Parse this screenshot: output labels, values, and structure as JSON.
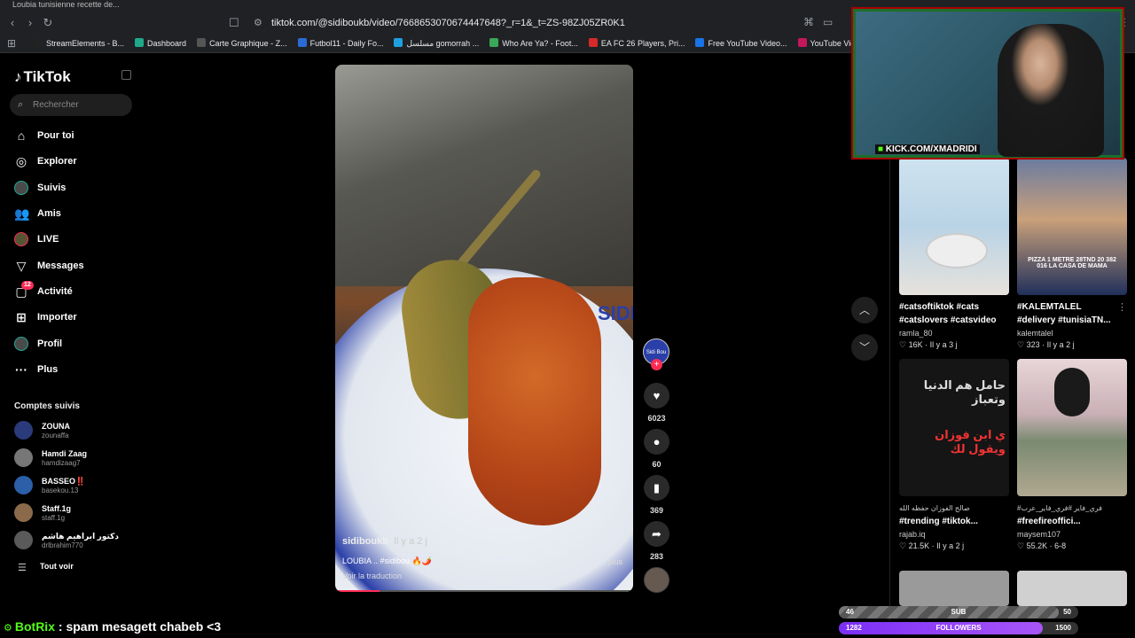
{
  "browser": {
    "tab_title": "Loubia tunisienne recette de...",
    "url": "tiktok.com/@sidiboukb/video/7668653070674447648?_r=1&_t=ZS-98ZJ05ZR0K1",
    "bookmarks": [
      {
        "label": "StreamElements - B...",
        "color": "#222"
      },
      {
        "label": "Dashboard",
        "color": "#1fa88a"
      },
      {
        "label": "Carte Graphique - Z...",
        "color": "#555"
      },
      {
        "label": "Futbol11 - Daily Fo...",
        "color": "#2a6bd6"
      },
      {
        "label": "مسلسل gomorrah ...",
        "color": "#1ea0e0"
      },
      {
        "label": "Who Are Ya? - Foot...",
        "color": "#3aa857"
      },
      {
        "label": "EA FC 26 Players, Pri...",
        "color": "#d62a2a"
      },
      {
        "label": "Free YouTube Video...",
        "color": "#1a73e8"
      },
      {
        "label": "YouTube Video Do...",
        "color": "#c2185b"
      }
    ]
  },
  "sidebar": {
    "logo": "TikTok",
    "search_placeholder": "Rechercher",
    "nav": [
      {
        "label": "Pour toi",
        "icon": "⌂"
      },
      {
        "label": "Explorer",
        "icon": "◎"
      },
      {
        "label": "Suivis",
        "icon": ""
      },
      {
        "label": "Amis",
        "icon": "👥"
      },
      {
        "label": "LIVE",
        "icon": ""
      },
      {
        "label": "Messages",
        "icon": "▽"
      },
      {
        "label": "Activité",
        "icon": "▢",
        "badge": "12"
      },
      {
        "label": "Importer",
        "icon": "⊞"
      },
      {
        "label": "Profil",
        "icon": ""
      },
      {
        "label": "Plus",
        "icon": "···"
      }
    ],
    "following_title": "Comptes suivis",
    "following": [
      {
        "name": "ZOUNA",
        "user": "zounaffa"
      },
      {
        "name": "Hamdi Zaag",
        "user": "hamdizaag7"
      },
      {
        "name": "BASSEO‼️",
        "user": "basekou.13"
      },
      {
        "name": "Staff.1g",
        "user": "staff.1g"
      },
      {
        "name": "دكتور ابراهيم هاشم",
        "user": "drlbrahim770"
      }
    ],
    "see_all": "Tout voir"
  },
  "video": {
    "overlay_text": "SIDI",
    "username": "sidiboukb",
    "time": "Il y a 2 j",
    "caption": "LOUBIA .. #sidibou 🔥🌶️",
    "more": "plus",
    "translate": "Voir la traduction",
    "progress": 0.15
  },
  "actions": {
    "avatar_label": "Sidi Bou",
    "likes": "6023",
    "comments": "60",
    "saves": "369",
    "shares": "283"
  },
  "feed": [
    {
      "title": "#catsoftiktok #cats #catslovers #catsvideo",
      "line1": "#catsoftiktok #cats",
      "line2": "#catslovers #catsvideo",
      "user": "ramla_80",
      "stats": "♡ 16K · Il y a 3 j",
      "overlay": ""
    },
    {
      "title": "#KALEMTALEL",
      "line1": "#KALEMTALEL",
      "line2": "#delivery #tunisiaTN...",
      "user": "kalemtalel",
      "stats": "♡ 323 · Il y a 2 j",
      "overlay": "PIZZA 1 METRE 28TND 20 382 016 LA CASA DE MAMA"
    },
    {
      "title": "",
      "line1": "صالح الفوزان حفظه الله",
      "line2": "#trending #tiktok...",
      "user": "rajab.iq",
      "stats": "♡ 21.5K · Il y a 2 j",
      "overlay": "حامل هم الدنيا وتعباز | ي ابن فوزان ويقول لك"
    },
    {
      "title": "",
      "line1": "#فري_فاير #فري_فاير_عرب",
      "line2": "#freefireoffici...",
      "user": "maysem107",
      "stats": "♡ 55.2K · 6-8",
      "overlay": ""
    }
  ],
  "stream": {
    "webcam_text": "KICK.COM/XMADRIDI",
    "chat_bot": "BotRix",
    "chat_msg": ": spam mesagett chabeb <3",
    "sub_goal": {
      "label": "SUB",
      "current": "46",
      "target": "50",
      "fraction": 0.92
    },
    "follow_goal": {
      "label": "FOLLOWERS",
      "current": "1282",
      "target": "1500",
      "fraction": 0.85
    }
  }
}
